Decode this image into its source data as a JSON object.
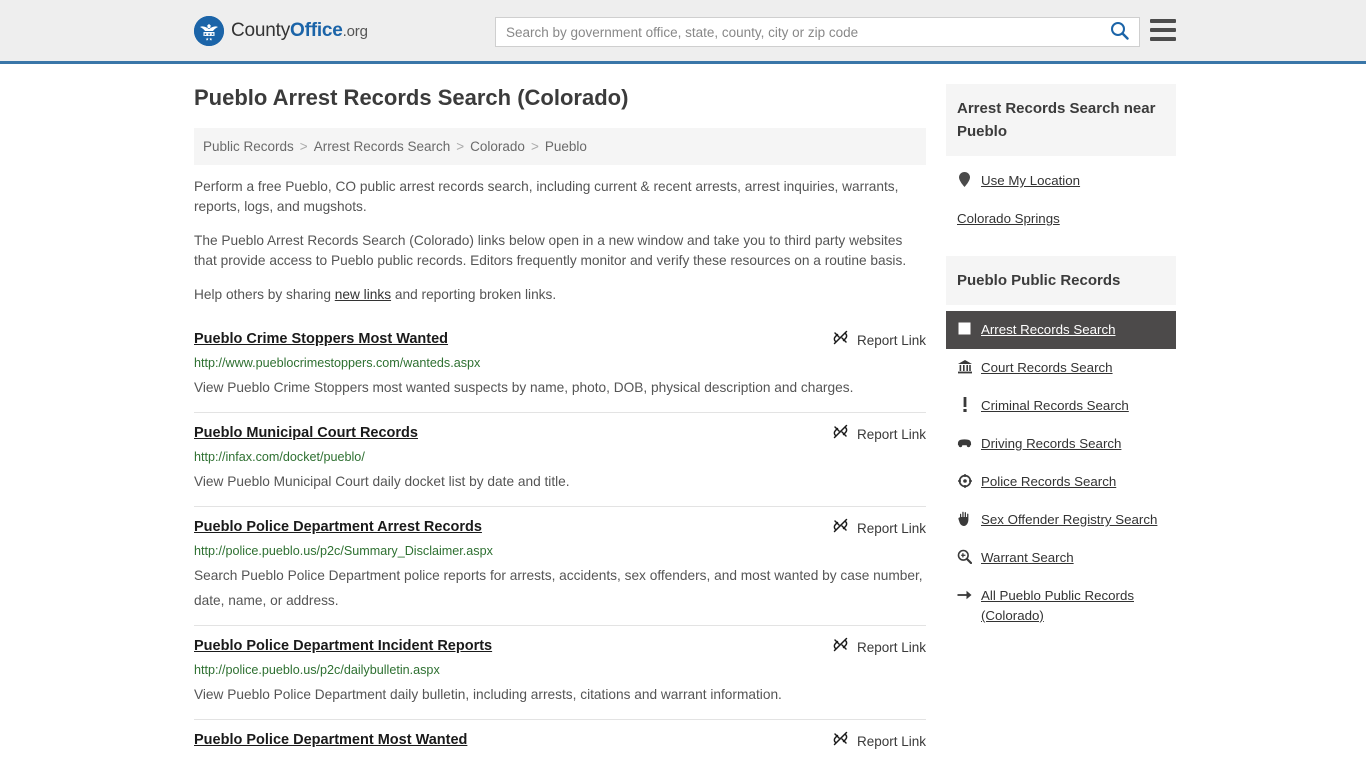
{
  "header": {
    "logo": {
      "part1": "County",
      "part2": "Office",
      "tld": ".org",
      "icon": "eagle-seal-icon"
    },
    "search": {
      "value": "",
      "placeholder": "Search by government office, state, county, city or zip code",
      "icon": "search-icon"
    },
    "menu_icon": "hamburger-menu-icon"
  },
  "main": {
    "title": "Pueblo Arrest Records Search (Colorado)",
    "breadcrumb": [
      {
        "label": "Public Records"
      },
      {
        "label": "Arrest Records Search"
      },
      {
        "label": "Colorado"
      },
      {
        "label": "Pueblo"
      }
    ],
    "breadcrumb_separator": ">",
    "intro": {
      "p1": "Perform a free Pueblo, CO public arrest records search, including current & recent arrests, arrest inquiries, warrants, reports, logs, and mugshots.",
      "p2": "The Pueblo Arrest Records Search (Colorado) links below open in a new window and take you to third party websites that provide access to Pueblo public records. Editors frequently monitor and verify these resources on a routine basis.",
      "p3_before": "Help others by sharing ",
      "p3_link": "new links",
      "p3_after": " and reporting broken links."
    },
    "report_link_label": "Report Link",
    "report_link_icon": "broken-link-icon",
    "results": [
      {
        "title": "Pueblo Crime Stoppers Most Wanted",
        "url": "http://www.pueblocrimestoppers.com/wanteds.aspx",
        "description": "View Pueblo Crime Stoppers most wanted suspects by name, photo, DOB, physical description and charges."
      },
      {
        "title": "Pueblo Municipal Court Records",
        "url": "http://infax.com/docket/pueblo/",
        "description": "View Pueblo Municipal Court daily docket list by date and title."
      },
      {
        "title": "Pueblo Police Department Arrest Records",
        "url": "http://police.pueblo.us/p2c/Summary_Disclaimer.aspx",
        "description": "Search Pueblo Police Department police reports for arrests, accidents, sex offenders, and most wanted by case number, date, name, or address."
      },
      {
        "title": "Pueblo Police Department Incident Reports",
        "url": "http://police.pueblo.us/p2c/dailybulletin.aspx",
        "description": "View Pueblo Police Department daily bulletin, including arrests, citations and warrant information."
      },
      {
        "title": "Pueblo Police Department Most Wanted",
        "url": "",
        "description": ""
      }
    ]
  },
  "sidebar": {
    "near_box": {
      "heading": "Arrest Records Search near Pueblo",
      "items": [
        {
          "label": "Use My Location",
          "icon": "map-pin-icon"
        },
        {
          "label": "Colorado Springs",
          "icon": ""
        }
      ]
    },
    "records_box": {
      "heading": "Pueblo Public Records",
      "items": [
        {
          "label": "Arrest Records Search",
          "icon": "handcuffs-square-icon",
          "active": true
        },
        {
          "label": "Court Records Search",
          "icon": "courthouse-icon",
          "active": false
        },
        {
          "label": "Criminal Records Search",
          "icon": "exclamation-icon",
          "active": false
        },
        {
          "label": "Driving Records Search",
          "icon": "car-icon",
          "active": false
        },
        {
          "label": "Police Records Search",
          "icon": "police-badge-icon",
          "active": false
        },
        {
          "label": "Sex Offender Registry Search",
          "icon": "hand-icon",
          "active": false
        },
        {
          "label": "Warrant Search",
          "icon": "magnifier-plus-icon",
          "active": false
        },
        {
          "label": "All Pueblo Public Records (Colorado)",
          "icon": "arrow-right-icon",
          "active": false
        }
      ]
    }
  },
  "colors": {
    "header_bg": "#eeeeee",
    "header_border": "#3a76a8",
    "brand_blue": "#1b64a8",
    "url_green": "#2e7031",
    "active_item_bg": "#4c4a4a",
    "panel_gray": "#f5f5f5"
  }
}
